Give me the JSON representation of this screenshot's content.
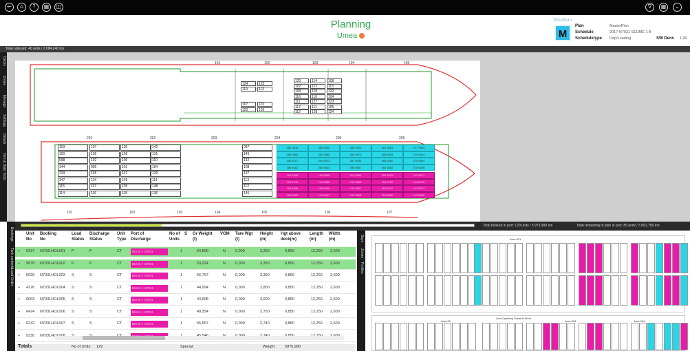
{
  "topbar": {
    "left_icons": [
      "back-icon",
      "home-icon",
      "help-icon",
      "print-icon",
      "copy-icon"
    ],
    "right_icons": [
      "vessel-icon",
      "grid-icon",
      "settings-icon"
    ]
  },
  "header": {
    "title": "Planning",
    "subtitle": "Umea",
    "status_color": "#f07a3c"
  },
  "situation": {
    "label": "Situation",
    "logo": "M",
    "plan_key": "Plan",
    "plan_value": "MasterPlan",
    "schedule_key": "Schedule",
    "schedule_value": "2017 N7031 SEUME 1 B",
    "scheduletype_key": "Scheduletype",
    "scheduletype_value": "Dep/Loading",
    "swdens_key": "SW Dens",
    "swdens_value": "1,00"
  },
  "summary_strip": "Total onboard: 40 units / 2 084,240 ton",
  "left_tabs": [
    "Decks",
    "Zones",
    "Manage",
    "Settings",
    "Details",
    "Tare & Stab",
    "Tools"
  ],
  "vessel": {
    "upper_bays": [
      "101",
      "102",
      "103",
      "104",
      "105"
    ],
    "main_bays": [
      "201",
      "202",
      "203",
      "204",
      "205",
      "206"
    ],
    "lower_bays": [
      "101",
      "102",
      "103",
      "104",
      "105",
      "106",
      "107"
    ],
    "upper_cells": [
      "124",
      "125",
      "119",
      "113",
      "107",
      "101",
      "120",
      "126",
      "120",
      "114",
      "108",
      "102",
      "121",
      "115",
      "109",
      "103",
      "122",
      "116",
      "110",
      "104",
      "111",
      "127",
      "123",
      "117",
      "111",
      "105",
      "112",
      "128",
      "124",
      "118",
      "112",
      "106"
    ],
    "main_white_cells": [
      "103",
      "107",
      "130",
      "142",
      "097",
      "100",
      "105",
      "109",
      "131",
      "143",
      "098",
      "102",
      "106",
      "110",
      "132",
      "144",
      "099",
      "101",
      "104",
      "108",
      "133",
      "145",
      "141",
      "139",
      "137",
      "147",
      "134",
      "149",
      "111",
      "113",
      "115",
      "117",
      "135",
      "148",
      "112",
      "114",
      "116",
      "118",
      "136",
      "146"
    ],
    "cyan_cargo": [
      "081 0418",
      "086 5390",
      "085 5530",
      "081 5063",
      "077 5964",
      "084 5886",
      "082 5080",
      "086 5870",
      "084 6098",
      "079 6544",
      "085 6117",
      "085 5513",
      "087 5936",
      "085 6260",
      "079 6544",
      "086 6262",
      "080 5644",
      "086 5567",
      "082 5808",
      "078 6208"
    ],
    "magenta_cargo": [
      "116 5436",
      "126 6986",
      "118 6360",
      "118 5078",
      "112 5677",
      "115 5776",
      "124 5986",
      "120 5366",
      "116 5752",
      "114 6076",
      "116 5406",
      "128 5466",
      "122 5537",
      "119 5337",
      "112 5377",
      "116 5387",
      "124 5407",
      "123 5506",
      "116 5300",
      "112 5506"
    ]
  },
  "status": {
    "booked": "Total booked in port: 129 units / 5 975,990 ton",
    "remaining": "Total remaining to plan in port: 89 units / 3 891,756 ton"
  },
  "bottom_left_tabs": [
    "Bookings",
    "Tank contents",
    "Load Order"
  ],
  "table": {
    "headers": [
      {
        "l1": "Unit",
        "l2": "No"
      },
      {
        "l1": "Booking",
        "l2": "No"
      },
      {
        "l1": "Load",
        "l2": "Status"
      },
      {
        "l1": "Discharge",
        "l2": "Status"
      },
      {
        "l1": "Unit",
        "l2": "Type"
      },
      {
        "l1": "Port of",
        "l2": "Discharge"
      },
      {
        "l1": "No of",
        "l2": "Units"
      },
      {
        "l1": "S",
        "l2": ""
      },
      {
        "l1": "Gr Weight",
        "l2": "(t)"
      },
      {
        "l1": "VGM",
        "l2": ""
      },
      {
        "l1": "Tare Wgt",
        "l2": "(t)"
      },
      {
        "l1": "Height",
        "l2": "(m)"
      },
      {
        "l1": "Hgt above",
        "l2": "deck(m)"
      },
      {
        "l1": "Length",
        "l2": "(m)"
      },
      {
        "l1": "Width",
        "l2": "(m)"
      }
    ],
    "rows": [
      {
        "unit": "5337",
        "booking": "N7031HOL001",
        "load": "P",
        "disch": "P",
        "type": "CT",
        "port": "BUUS > N7031",
        "units": "1",
        "gw": "54,890",
        "vgm": "N",
        "tare": "0,000",
        "height": "3,350",
        "hgt": "0,850",
        "length": "12,250",
        "width": "2,600",
        "hl": true
      },
      {
        "unit": "5878",
        "booking": "N7031HOL002",
        "load": "P",
        "disch": "P",
        "type": "CT",
        "port": "BUUS > N7031",
        "units": "1",
        "gw": "53,224",
        "vgm": "N",
        "tare": "0,000",
        "height": "3,350",
        "hgt": "0,850",
        "length": "12,250",
        "width": "2,600",
        "hl": true
      },
      {
        "unit": "5039",
        "booking": "N7031HOL003",
        "load": "S",
        "disch": "S",
        "type": "CT",
        "port": "BUUS > N7031",
        "units": "1",
        "gw": "56,767",
        "vgm": "N",
        "tare": "0,000",
        "height": "3,350",
        "hgt": "0,850",
        "length": "12,250",
        "width": "2,600",
        "hl": false
      },
      {
        "unit": "4226",
        "booking": "N7031HOL004",
        "load": "S",
        "disch": "S",
        "type": "CT",
        "port": "BUUS > N7031",
        "units": "1",
        "gw": "44,994",
        "vgm": "N",
        "tare": "0,000",
        "height": "2,800",
        "hgt": "0,850",
        "length": "12,250",
        "width": "2,600",
        "hl": false
      },
      {
        "unit": "6003",
        "booking": "N7031HOL005",
        "load": "S",
        "disch": "S",
        "type": "CT",
        "port": "BUUS > N7031",
        "units": "1",
        "gw": "44,608",
        "vgm": "N",
        "tare": "0,000",
        "height": "2,600",
        "hgt": "0,850",
        "length": "12,250",
        "width": "2,600",
        "hl": false
      },
      {
        "unit": "6424",
        "booking": "N7031HOL006",
        "load": "S",
        "disch": "S",
        "type": "CT",
        "port": "BUUS > N7031",
        "units": "1",
        "gw": "49,254",
        "vgm": "N",
        "tare": "0,000",
        "height": "2,750",
        "hgt": "0,850",
        "length": "12,250",
        "width": "2,600",
        "hl": false
      },
      {
        "unit": "6242",
        "booking": "N7031HOL007",
        "load": "S",
        "disch": "S",
        "type": "CT",
        "port": "BUUS > N7031",
        "units": "1",
        "gw": "55,557",
        "vgm": "N",
        "tare": "0,000",
        "height": "2,740",
        "hgt": "0,850",
        "length": "12,250",
        "width": "2,600",
        "hl": false
      },
      {
        "unit": "5330",
        "booking": "N7031HOL008",
        "load": "S",
        "disch": "S",
        "type": "CT",
        "port": "BUUS > N7031",
        "units": "1",
        "gw": "45,546",
        "vgm": "N",
        "tare": "0,000",
        "height": "2,740",
        "hgt": "0,850",
        "length": "12,250",
        "width": "2,600",
        "hl": false
      }
    ]
  },
  "totals": {
    "label": "Totals",
    "units_label": "No of Units:",
    "units_value": "129",
    "special_label": "Special:",
    "weight_label": "Weight:",
    "weight_value": "5975,990"
  },
  "right_tabs": [
    "Bays",
    "Zones",
    "Profiles"
  ],
  "bay_plan": {
    "group_top": "Area 001",
    "group_mid": "Area Opening Towards Stern",
    "group_labels": [
      "Area 02",
      "Area 003",
      "Area 004"
    ]
  },
  "colors": {
    "accent_green": "#2fa84f",
    "cargo_cyan": "#29d6e6",
    "cargo_magenta": "#e81ca8",
    "row_highlight": "#8fe08f",
    "hull_red": "#e03030",
    "deck_green": "#1f9a2a"
  }
}
